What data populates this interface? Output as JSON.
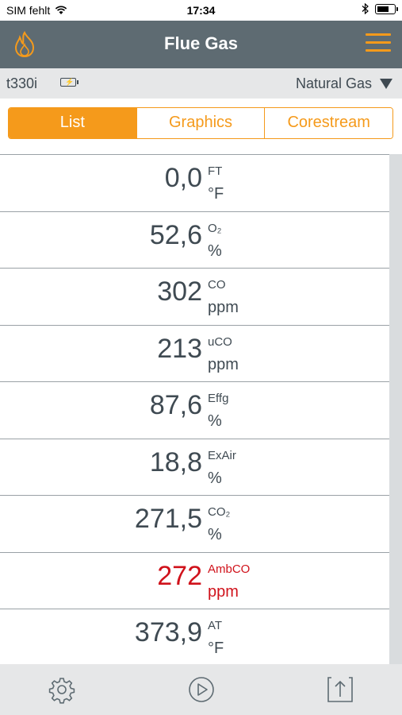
{
  "status_bar": {
    "carrier": "SIM fehlt",
    "time": "17:34"
  },
  "header": {
    "title": "Flue Gas",
    "left_icon": "flame-icon",
    "right_icon": "menu-icon"
  },
  "device": {
    "name": "t330i",
    "fuel": "Natural Gas"
  },
  "tabs": [
    {
      "label": "List",
      "active": true
    },
    {
      "label": "Graphics",
      "active": false
    },
    {
      "label": "Corestream",
      "active": false
    }
  ],
  "measurements": [
    {
      "value": "0,0",
      "param": "FT",
      "unit": "°F",
      "alarm": false
    },
    {
      "value": "52,6",
      "param": "O₂",
      "unit": "%",
      "alarm": false
    },
    {
      "value": "302",
      "param": "CO",
      "unit": "ppm",
      "alarm": false
    },
    {
      "value": "213",
      "param": "uCO",
      "unit": "ppm",
      "alarm": false
    },
    {
      "value": "87,6",
      "param": "Effg",
      "unit": "%",
      "alarm": false
    },
    {
      "value": "18,8",
      "param": "ExAir",
      "unit": "%",
      "alarm": false
    },
    {
      "value": "271,5",
      "param": "CO₂",
      "unit": "%",
      "alarm": false
    },
    {
      "value": "272",
      "param": "AmbCO",
      "unit": "ppm",
      "alarm": true
    },
    {
      "value": "373,9",
      "param": "AT",
      "unit": "°F",
      "alarm": false
    }
  ],
  "bottom_bar": {
    "icons": [
      "gear-icon",
      "play-icon",
      "export-icon"
    ]
  },
  "colors": {
    "accent": "#f59a1b",
    "header_bg": "#5e6b72",
    "text": "#3f4a52",
    "alarm": "#d0121b"
  }
}
